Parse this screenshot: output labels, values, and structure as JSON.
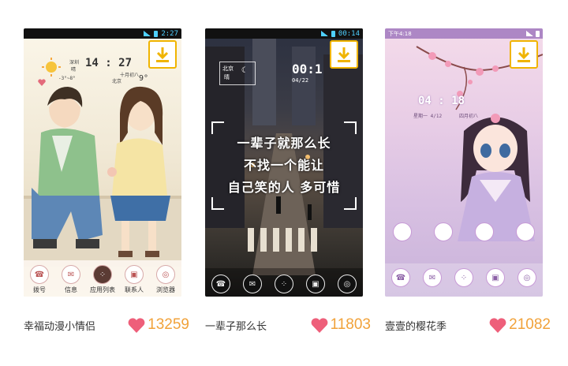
{
  "cards": [
    {
      "title": "幸福动漫小情侣",
      "likes": "13259",
      "status_time": "2:27",
      "widget": {
        "city": "深圳",
        "weather": "晴",
        "temp_range": "-3°~8°",
        "time": "14 : 27",
        "date": "十月初八",
        "district": "北京",
        "temp": "9°"
      },
      "dock": [
        {
          "label": "拨号",
          "icon": "phone-icon"
        },
        {
          "label": "信息",
          "icon": "message-icon"
        },
        {
          "label": "应用列表",
          "icon": "app-grid-icon"
        },
        {
          "label": "联系人",
          "icon": "contacts-icon"
        },
        {
          "label": "浏览器",
          "icon": "browser-icon"
        }
      ]
    },
    {
      "title": "一辈子那么长",
      "likes": "11803",
      "status_time": "00:14",
      "widget": {
        "city": "北京",
        "weather": "晴",
        "time": "00:1",
        "date": "04/22"
      },
      "quote": [
        "一辈子就那么长",
        "不找一个能让",
        "自己笑的人 多可惜"
      ],
      "dock_icons": [
        "phone-icon",
        "message-icon",
        "app-grid-icon",
        "contacts-icon",
        "browser-icon"
      ]
    },
    {
      "title": "壹壹的樱花季",
      "likes": "21082",
      "status_time": "下午4:18",
      "widget": {
        "time": "04 : 18",
        "date_left": "星期一 4/12",
        "date_right": "四月初八"
      },
      "dock_icons": [
        "phone-icon",
        "message-icon",
        "app-grid-icon",
        "contacts-icon",
        "browser-icon"
      ]
    }
  ],
  "colors": {
    "accent": "#f0b400",
    "heart": "#ee5f7a",
    "count": "#f1a23a"
  }
}
